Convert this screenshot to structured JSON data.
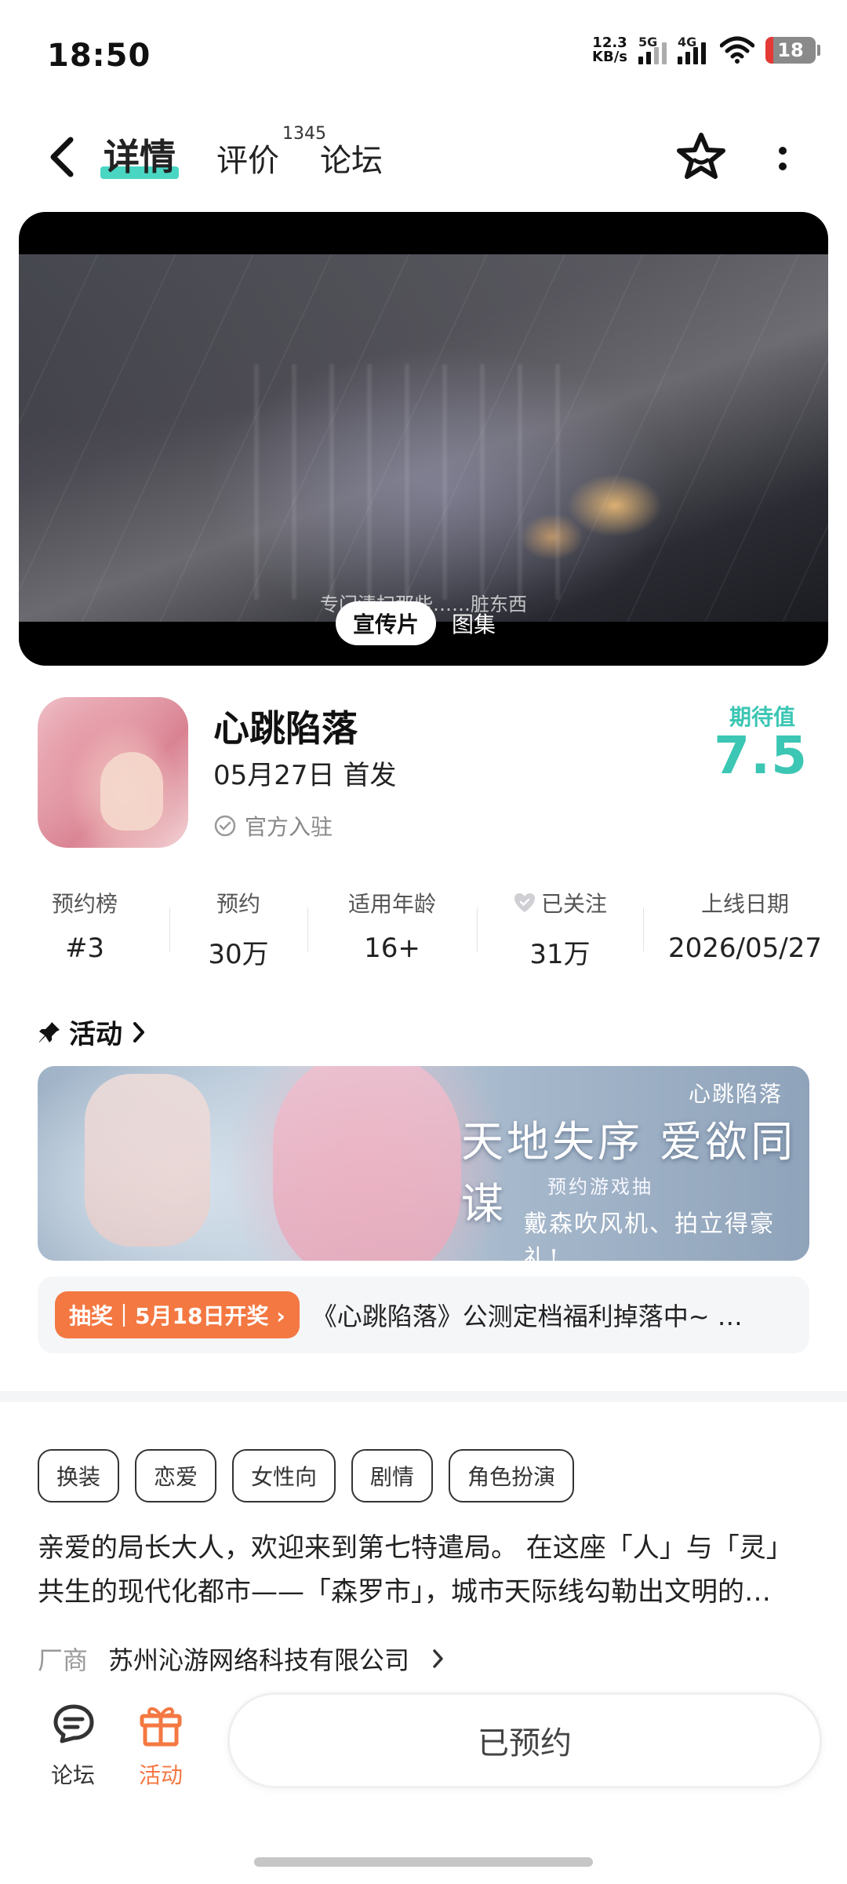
{
  "status_bar": {
    "time": "18:50",
    "net_speed_top": "12.3",
    "net_speed_bottom": "KB/s",
    "signal1_label": "5G",
    "signal2_label": "4G",
    "battery": "18"
  },
  "nav": {
    "tabs": [
      {
        "label": "详情",
        "active": true
      },
      {
        "label": "评价"
      },
      {
        "label": "论坛"
      }
    ],
    "review_count": "1345"
  },
  "video": {
    "subtitle": "专门清扫那些……脏东西",
    "tabs": [
      {
        "label": "宣传片",
        "active": true
      },
      {
        "label": "图集"
      }
    ]
  },
  "game": {
    "name": "心跳陷落",
    "release": "05月27日 首发",
    "official": "官方入驻",
    "expect_label": "期待值",
    "expect_score": "7.5"
  },
  "stats": [
    {
      "label": "预约榜",
      "value": "#3"
    },
    {
      "label": "预约",
      "value": "30万"
    },
    {
      "label": "适用年龄",
      "value": "16+"
    },
    {
      "label": "已关注",
      "value": "31万"
    },
    {
      "label": "上线日期",
      "value": "2026/05/27"
    }
  ],
  "activity": {
    "title": "活动",
    "banner": {
      "logo": "心跳陷落",
      "slogan": "天地失序 爱欲同谋",
      "sub": "预约游戏抽",
      "prize": "戴森吹风机、拍立得豪礼!"
    },
    "lottery_tag": "抽奖｜5月18日开奖 ›",
    "lottery_text": "《心跳陷落》公测定档福利掉落中~ …"
  },
  "tags": [
    "换装",
    "恋爱",
    "女性向",
    "剧情",
    "角色扮演"
  ],
  "description": {
    "line1": "亲爱的局长大人，欢迎来到第七特遣局。 在这座「人」与「灵」",
    "line2": "共生的现代化都市——「森罗市」，城市天际线勾勒出文明的…"
  },
  "vendor": {
    "label": "厂商",
    "value": "苏州沁游网络科技有限公司"
  },
  "bottom": {
    "forum_label": "论坛",
    "event_label": "活动",
    "reserve_label": "已预约"
  },
  "colors": {
    "accent_teal": "#3cc6b4",
    "tab_underline": "#49d6c3",
    "orange": "#f47842"
  }
}
